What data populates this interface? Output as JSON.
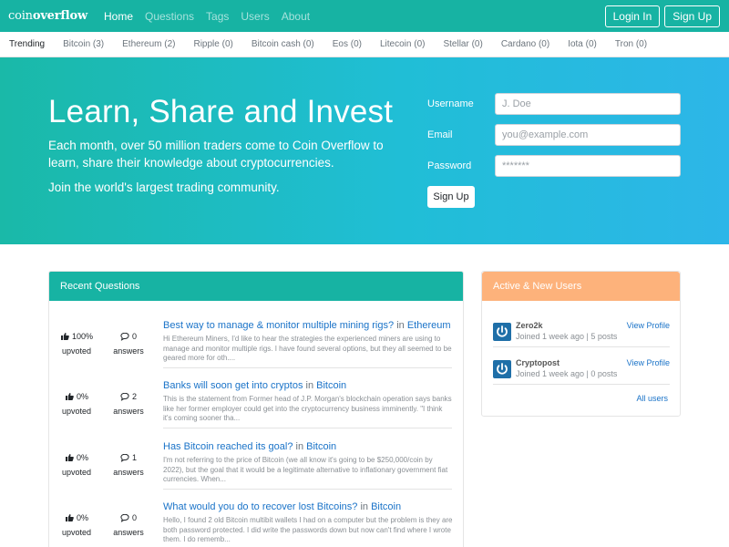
{
  "navbar": {
    "brand_light": "coin",
    "brand_bold": "overflow",
    "links": [
      "Home",
      "Questions",
      "Tags",
      "Users",
      "About"
    ],
    "login_label": "Login In",
    "signup_label": "Sign Up"
  },
  "trending": {
    "label": "Trending",
    "items": [
      "Bitcoin (3)",
      "Ethereum (2)",
      "Ripple (0)",
      "Bitcoin cash (0)",
      "Eos (0)",
      "Litecoin (0)",
      "Stellar (0)",
      "Cardano (0)",
      "Iota (0)",
      "Tron (0)"
    ]
  },
  "hero": {
    "title": "Learn, Share and Invest",
    "lead": "Each month, over 50 million traders come to Coin Overflow to learn, share their knowledge about cryptocurrencies.",
    "join": "Join the world's largest trading community.",
    "form": {
      "username_label": "Username",
      "username_placeholder": "J. Doe",
      "email_label": "Email",
      "email_placeholder": "you@example.com",
      "password_label": "Password",
      "password_placeholder": "*******",
      "submit_label": "Sign Up"
    }
  },
  "recent": {
    "header": "Recent Questions",
    "upvoted_label": "upvoted",
    "answers_label": "answers",
    "in_label": "in",
    "questions": [
      {
        "upvote": "100%",
        "answers": "0",
        "title": "Best way to manage & monitor multiple mining rigs?",
        "category": "Ethereum",
        "excerpt": "Hi Ethereum Miners, I'd like to hear the strategies the experienced miners are using to manage and monitor multiple rigs. I have found several options, but they all seemed to be geared more for oth...."
      },
      {
        "upvote": "0%",
        "answers": "2",
        "title": "Banks will soon get into cryptos",
        "category": "Bitcoin",
        "excerpt": "This is the statement from Former head of J.P. Morgan's blockchain operation says banks like her former employer could get into the cryptocurrency business imminently. \"I think it's coming sooner tha..."
      },
      {
        "upvote": "0%",
        "answers": "1",
        "title": "Has Bitcoin reached its goal?",
        "category": "Bitcoin",
        "excerpt": "I'm not referring to the price of Bitcoin (we all know it's going to be $250,000/coin by 2022), but the goal that it would be a legitimate alternative to inflationary government fiat currencies. When..."
      },
      {
        "upvote": "0%",
        "answers": "0",
        "title": "What would you do to recover lost Bitcoins?",
        "category": "Bitcoin",
        "excerpt": "Hello, I found 2 old Bitcoin multibit wallets I had on a computer but the problem is they are both password protected. I did write the passwords down but now can't find where I wrote them. I do rememb..."
      }
    ]
  },
  "users": {
    "header": "Active & New Users",
    "view_profile_label": "View Profile",
    "all_users_label": "All users",
    "list": [
      {
        "name": "Zero2k",
        "meta": "Joined 1 week ago | 5 posts"
      },
      {
        "name": "Cryptopost",
        "meta": "Joined 1 week ago | 0 posts"
      }
    ]
  },
  "colors": {
    "navbar": "#17b3a3",
    "hero_start": "#1ab9a8",
    "hero_end": "#2db6e8",
    "users_header": "#fdb27b",
    "link": "#1a73c8"
  }
}
